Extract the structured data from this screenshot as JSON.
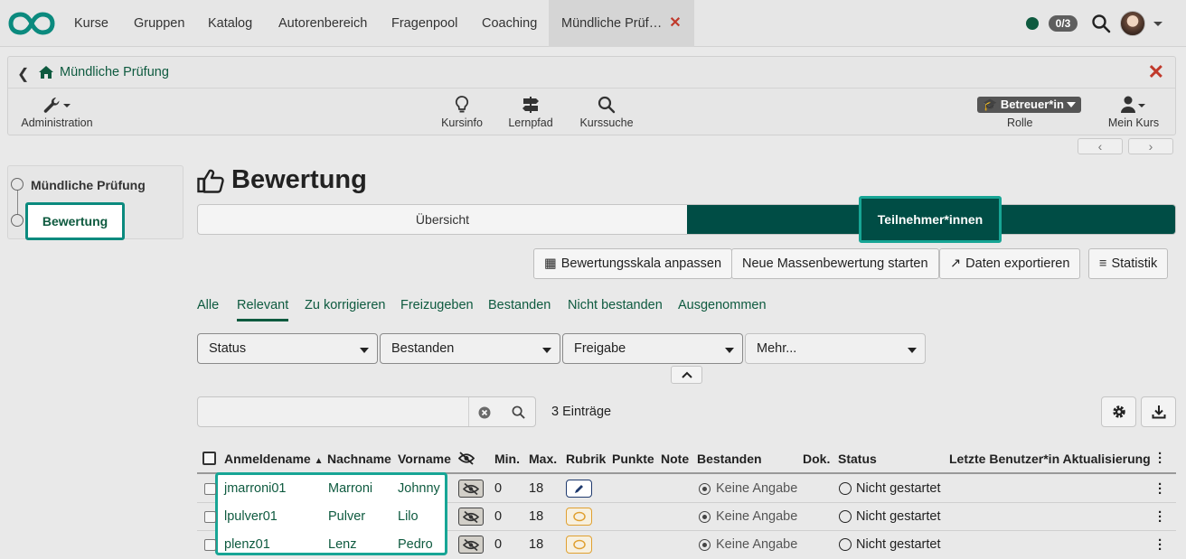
{
  "nav": {
    "items": [
      "Kurse",
      "Gruppen",
      "Katalog",
      "Autorenbereich",
      "Fragenpool",
      "Coaching"
    ],
    "active_tab": "Mündliche Prüf…",
    "badge": "0/3"
  },
  "course": {
    "title": "Mündliche Prüfung",
    "tools": {
      "administration": "Administration",
      "kursinfo": "Kursinfo",
      "lernpfad": "Lernpfad",
      "kurssuche": "Kurssuche",
      "mein_kurs": "Mein Kurs"
    },
    "role_value": "Betreuer*in",
    "role_label": "Rolle"
  },
  "menu": {
    "root": "Mündliche Prüfung",
    "active": "Bewertung"
  },
  "page": {
    "title": "Bewertung",
    "seg_tabs": [
      "Übersicht",
      "Teilnehmer*innen"
    ]
  },
  "actions": {
    "scale": "Bewertungsskala anpassen",
    "mass": "Neue Massenbewertung starten",
    "export": "Daten exportieren",
    "stats": "Statistik"
  },
  "filter_tabs": [
    "Alle",
    "Relevant",
    "Zu korrigieren",
    "Freizugeben",
    "Bestanden",
    "Nicht bestanden",
    "Ausgenommen"
  ],
  "filters": [
    "Status",
    "Bestanden",
    "Freigabe",
    "Mehr..."
  ],
  "table": {
    "count_text": "3 Einträge",
    "headers": {
      "login": "Anmeldename",
      "lastname": "Nachname",
      "firstname": "Vorname",
      "min": "Min.",
      "max": "Max.",
      "rubric": "Rubrik",
      "points": "Punkte",
      "note": "Note",
      "passed": "Bestanden",
      "doc": "Dok.",
      "status": "Status",
      "last_update": "Letzte Benutzer*in Aktualisierung"
    },
    "rows": [
      {
        "login": "jmarroni01",
        "lastname": "Marroni",
        "firstname": "Johnny",
        "min": "0",
        "max": "18",
        "passed": "Keine Angabe",
        "status": "Nicht gestartet"
      },
      {
        "login": "lpulver01",
        "lastname": "Pulver",
        "firstname": "Lilo",
        "min": "0",
        "max": "18",
        "passed": "Keine Angabe",
        "status": "Nicht gestartet"
      },
      {
        "login": "plenz01",
        "lastname": "Lenz",
        "firstname": "Pedro",
        "min": "0",
        "max": "18",
        "passed": "Keine Angabe",
        "status": "Nicht gestartet"
      }
    ]
  },
  "colors": {
    "brand": "#0e5a3f",
    "active_tab_bg": "#004d45",
    "highlight": "#17a595",
    "close": "#c0392b"
  }
}
